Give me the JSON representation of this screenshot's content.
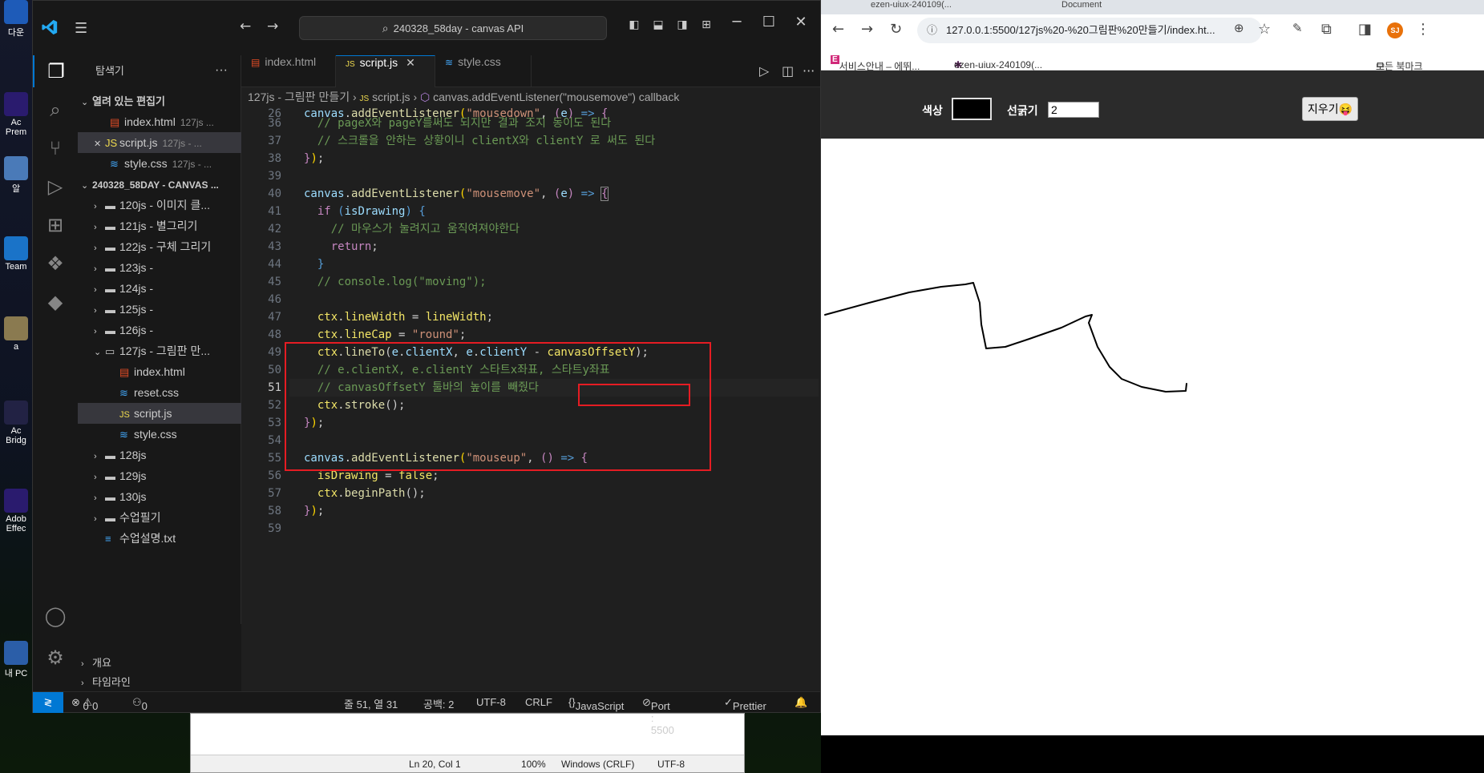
{
  "desktop": {
    "icons": [
      {
        "label": "다운",
        "color": "#1e5bb8"
      },
      {
        "label": "Ac Prem",
        "color": "#2a1b6e"
      },
      {
        "label": "알",
        "color": "#4a7ab8"
      },
      {
        "label": "Team",
        "color": "#1a73c8"
      },
      {
        "label": "a",
        "color": "#8a7a50"
      },
      {
        "label": "Ac Bridg",
        "color": "#222244"
      },
      {
        "label": "Adob Effec",
        "color": "#2a1b6e"
      },
      {
        "label": "내 PC",
        "color": "#2b5ea8"
      }
    ]
  },
  "notepad": {
    "position": "Ln 20, Col 1",
    "zoom": "100%",
    "eol": "Windows (CRLF)",
    "encoding": "UTF-8"
  },
  "vscode": {
    "command_center": "240328_58day - canvas API",
    "explorer_title": "탐색기",
    "open_editors_label": "열려 있는 편집기",
    "open_editors": [
      {
        "name": "index.html",
        "meta": "127js ...",
        "type": "html"
      },
      {
        "name": "script.js",
        "meta": "127js - ...",
        "type": "js"
      },
      {
        "name": "style.css",
        "meta": "127js - ...",
        "type": "css"
      }
    ],
    "workspace_label": "240328_58DAY - CANVAS ...",
    "tree": [
      {
        "name": "120js - 이미지 클...",
        "kind": "folder"
      },
      {
        "name": "121js - 별그리기",
        "kind": "folder"
      },
      {
        "name": "122js - 구체 그리기",
        "kind": "folder"
      },
      {
        "name": "123js -",
        "kind": "folder"
      },
      {
        "name": "124js -",
        "kind": "folder"
      },
      {
        "name": "125js -",
        "kind": "folder"
      },
      {
        "name": "126js -",
        "kind": "folder"
      },
      {
        "name": "127js - 그림판 만...",
        "kind": "folder-open"
      },
      {
        "name": "index.html",
        "kind": "html"
      },
      {
        "name": "reset.css",
        "kind": "css"
      },
      {
        "name": "script.js",
        "kind": "js"
      },
      {
        "name": "style.css",
        "kind": "css"
      },
      {
        "name": "128js",
        "kind": "folder"
      },
      {
        "name": "129js",
        "kind": "folder"
      },
      {
        "name": "130js",
        "kind": "folder"
      },
      {
        "name": "수업필기",
        "kind": "folder"
      },
      {
        "name": "수업설명.txt",
        "kind": "txt"
      }
    ],
    "outline_label": "개요",
    "timeline_label": "타임라인",
    "tabs": [
      {
        "label": "index.html",
        "type": "html"
      },
      {
        "label": "script.js",
        "type": "js"
      },
      {
        "label": "style.css",
        "type": "css"
      }
    ],
    "breadcrumb": {
      "folder": "127js - 그림판 만들기",
      "file": "script.js",
      "symbol": "canvas.addEventListener(\"mousemove\") callback"
    },
    "line_numbers": [
      "26",
      "36",
      "37",
      "38",
      "39",
      "40",
      "41",
      "42",
      "43",
      "44",
      "45",
      "46",
      "47",
      "48",
      "49",
      "50",
      "51",
      "52",
      "53",
      "54",
      "55",
      "56",
      "57",
      "58",
      "59"
    ],
    "code": [
      "canvas.addEventListener(\"mousedown\", (e) => {",
      "  // pageX와 pageY를써도 되지만 결과 조지 동이도 된다",
      "  // 스크롤을 안하는 상황이니 clientX와 clientY 로 써도 된다",
      "});",
      "",
      "canvas.addEventListener(\"mousemove\", (e) => {",
      "  if (isDrawing) {",
      "    // 마우스가 눌려지고 움직여져야한다",
      "    return;",
      "  }",
      "  // console.log(\"moving\");",
      "",
      "  ctx.lineWidth = lineWidth;",
      "  ctx.lineCap = \"round\";",
      "  ctx.lineTo(e.clientX, e.clientY - canvasOffsetY);",
      "  // e.clientX, e.clientY 스타트x좌표, 스타트y좌표",
      "  // canvasOffsetY 툴바의 높이를 빼줬다",
      "  ctx.stroke();",
      "});",
      "",
      "canvas.addEventListener(\"mouseup\", () => {",
      "  isDrawing = false;",
      "  ctx.beginPath();",
      "});",
      ""
    ],
    "status": {
      "errors": "0",
      "warnings": "0",
      "ports": "0",
      "cursor": "줄 51, 열 31",
      "indent": "공백: 2",
      "encoding": "UTF-8",
      "eol": "CRLF",
      "language": "JavaScript",
      "port": "Port : 5500",
      "prettier": "Prettier"
    }
  },
  "browser": {
    "tab1": "ezen-uiux-240109(...",
    "tab2": "Document",
    "url": "127.0.0.1:5500/127js%20-%20그림판%20만들기/index.ht...",
    "profile": "SJ",
    "bookmarks": [
      "서비스안내 – 에뛰...",
      "ezen-uiux-240109(..."
    ],
    "all_bookmarks": "모든 북마크",
    "app": {
      "color_label": "색상",
      "color_value": "#000000",
      "width_label": "선굵기",
      "width_value": "2",
      "erase_label": "지우기😝"
    }
  }
}
